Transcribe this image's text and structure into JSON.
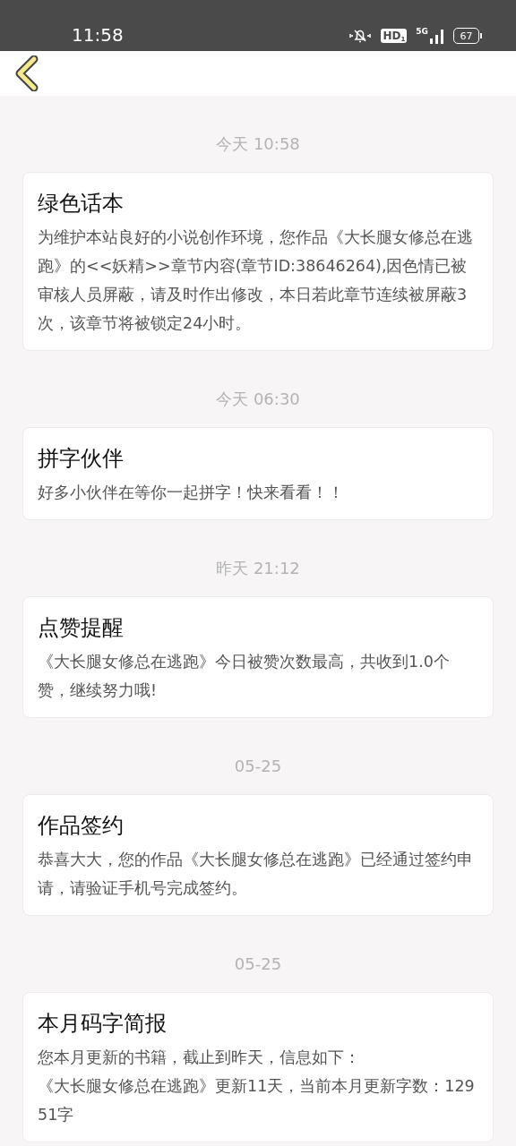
{
  "status_bar": {
    "time": "11:58",
    "hd_label": "HD",
    "hd_index": "1",
    "network": "5G",
    "battery": "67"
  },
  "messages": [
    {
      "time": "今天 10:58",
      "title": "绿色话本",
      "body": [
        "为维护本站良好的小说创作环境，您作品《大长腿女修总在逃跑》的<<妖精>>章节内容(章节ID:38646264),因色情已被审核人员屏蔽，请及时作出修改，本日若此章节连续被屏蔽3次，该章节将被锁定24小时。"
      ]
    },
    {
      "time": "今天 06:30",
      "title": "拼字伙伴",
      "body": [
        "好多小伙伴在等你一起拼字！快来看看！！"
      ]
    },
    {
      "time": "昨天 21:12",
      "title": "点赞提醒",
      "body": [
        "《大长腿女修总在逃跑》今日被赞次数最高，共收到1.0个赞，继续努力哦!"
      ]
    },
    {
      "time": "05-25",
      "title": "作品签约",
      "body": [
        "恭喜大大，您的作品《大长腿女修总在逃跑》已经通过签约申请，请验证手机号完成签约。"
      ]
    },
    {
      "time": "05-25",
      "title": "本月码字简报",
      "body": [
        "您本月更新的书籍，截止到昨天，信息如下：",
        "《大长腿女修总在逃跑》更新11天，当前本月更新字数：12951字"
      ]
    }
  ]
}
